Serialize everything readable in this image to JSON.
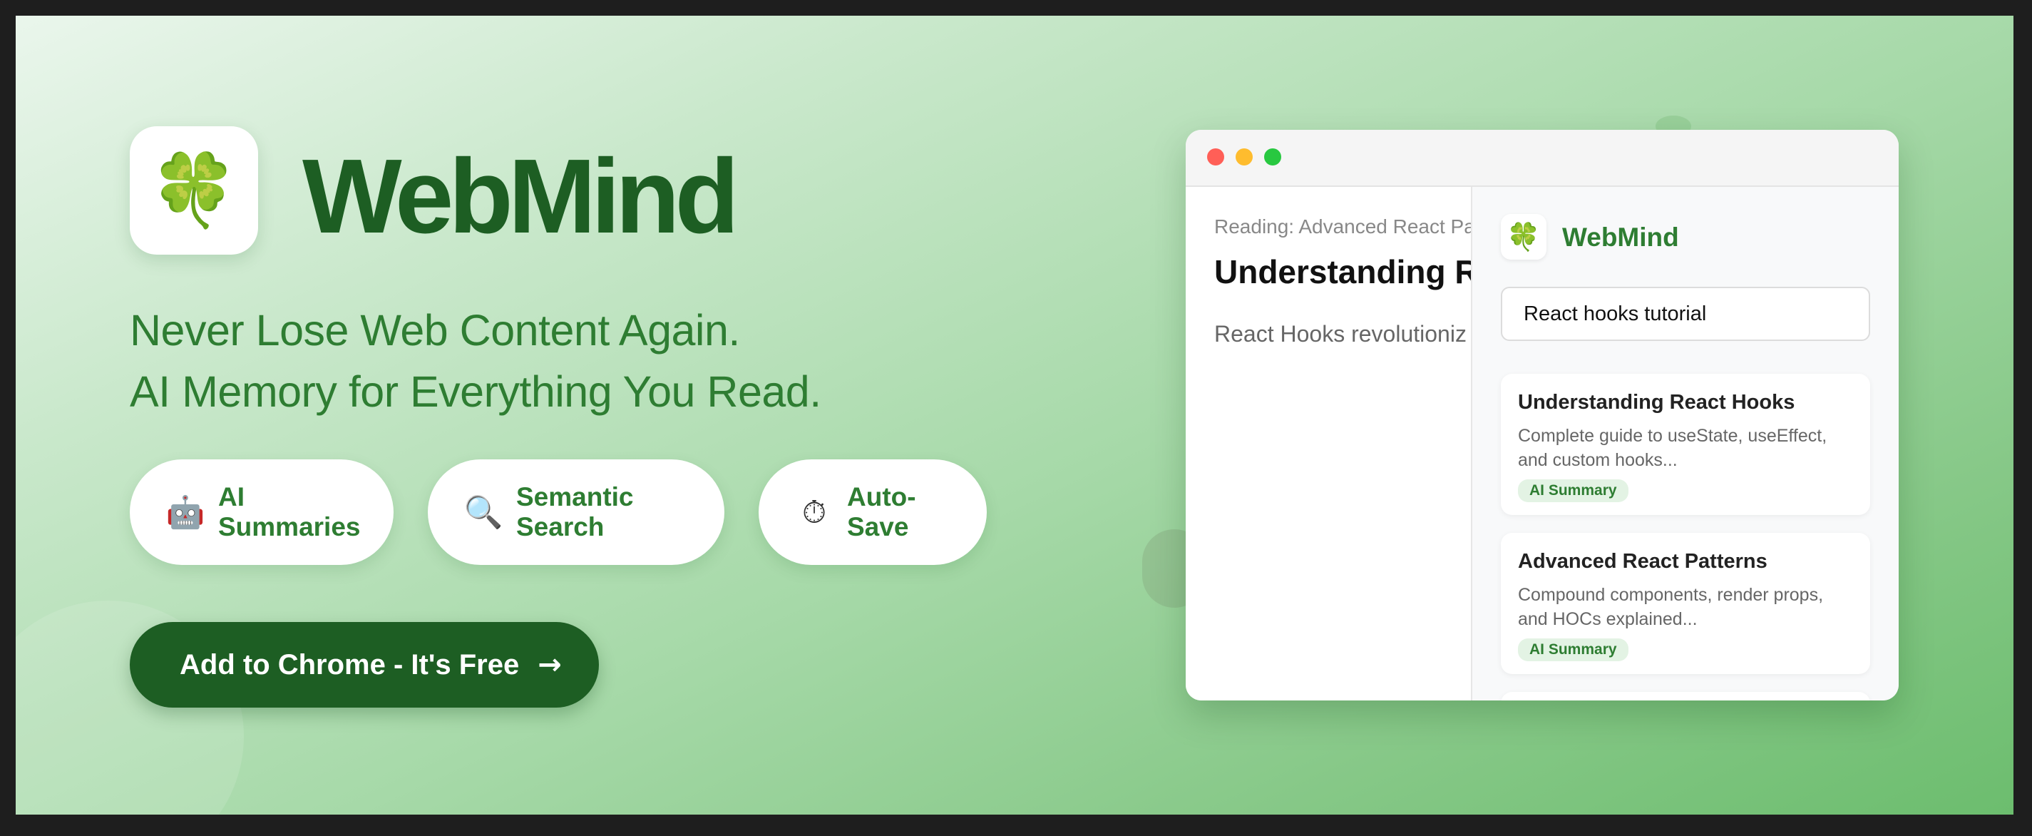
{
  "brand": {
    "logo_icon": "four-leaf-clover-icon",
    "logo_glyph": "🍀",
    "name": "WebMind"
  },
  "tagline": {
    "line1": "Never Lose Web Content Again.",
    "line2": "AI Memory for Everything You Read."
  },
  "features": [
    {
      "icon": "robot-icon",
      "glyph": "🤖",
      "line1": "AI",
      "line2": "Summaries"
    },
    {
      "icon": "magnifier-icon",
      "glyph": "🔍",
      "line1": "Semantic",
      "line2": "Search"
    },
    {
      "icon": "stopwatch-icon",
      "glyph": "⏱",
      "line1": "Auto-",
      "line2": "Save"
    }
  ],
  "cta": {
    "label": "Add to Chrome - It's Free",
    "arrow": "→"
  },
  "mockup": {
    "page": {
      "reading": "Reading: Advanced React Pa",
      "title": "Understanding R",
      "body": "React Hooks revolutioniz"
    },
    "panel": {
      "logo_glyph": "🍀",
      "brand": "WebMind",
      "search_value": "React hooks tutorial",
      "results": [
        {
          "title": "Understanding React Hooks",
          "desc": "Complete guide to useState, useEffect, and custom hooks...",
          "badge": "AI Summary"
        },
        {
          "title": "Advanced React Patterns",
          "desc": "Compound components, render props, and HOCs explained...",
          "badge": "AI Summary"
        }
      ]
    }
  },
  "colors": {
    "brand_dark": "#1d5e23",
    "brand": "#2e7d32",
    "badge_bg": "#e3f3e4"
  }
}
